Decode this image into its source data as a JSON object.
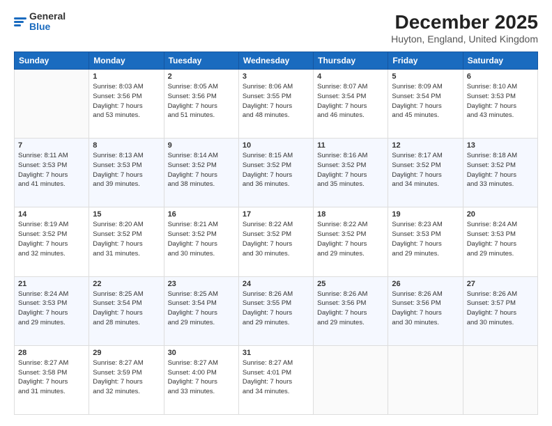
{
  "header": {
    "logo_general": "General",
    "logo_blue": "Blue",
    "month_title": "December 2025",
    "location": "Huyton, England, United Kingdom"
  },
  "days_of_week": [
    "Sunday",
    "Monday",
    "Tuesday",
    "Wednesday",
    "Thursday",
    "Friday",
    "Saturday"
  ],
  "weeks": [
    [
      {
        "day": "",
        "content": ""
      },
      {
        "day": "1",
        "content": "Sunrise: 8:03 AM\nSunset: 3:56 PM\nDaylight: 7 hours\nand 53 minutes."
      },
      {
        "day": "2",
        "content": "Sunrise: 8:05 AM\nSunset: 3:56 PM\nDaylight: 7 hours\nand 51 minutes."
      },
      {
        "day": "3",
        "content": "Sunrise: 8:06 AM\nSunset: 3:55 PM\nDaylight: 7 hours\nand 48 minutes."
      },
      {
        "day": "4",
        "content": "Sunrise: 8:07 AM\nSunset: 3:54 PM\nDaylight: 7 hours\nand 46 minutes."
      },
      {
        "day": "5",
        "content": "Sunrise: 8:09 AM\nSunset: 3:54 PM\nDaylight: 7 hours\nand 45 minutes."
      },
      {
        "day": "6",
        "content": "Sunrise: 8:10 AM\nSunset: 3:53 PM\nDaylight: 7 hours\nand 43 minutes."
      }
    ],
    [
      {
        "day": "7",
        "content": "Sunrise: 8:11 AM\nSunset: 3:53 PM\nDaylight: 7 hours\nand 41 minutes."
      },
      {
        "day": "8",
        "content": "Sunrise: 8:13 AM\nSunset: 3:53 PM\nDaylight: 7 hours\nand 39 minutes."
      },
      {
        "day": "9",
        "content": "Sunrise: 8:14 AM\nSunset: 3:52 PM\nDaylight: 7 hours\nand 38 minutes."
      },
      {
        "day": "10",
        "content": "Sunrise: 8:15 AM\nSunset: 3:52 PM\nDaylight: 7 hours\nand 36 minutes."
      },
      {
        "day": "11",
        "content": "Sunrise: 8:16 AM\nSunset: 3:52 PM\nDaylight: 7 hours\nand 35 minutes."
      },
      {
        "day": "12",
        "content": "Sunrise: 8:17 AM\nSunset: 3:52 PM\nDaylight: 7 hours\nand 34 minutes."
      },
      {
        "day": "13",
        "content": "Sunrise: 8:18 AM\nSunset: 3:52 PM\nDaylight: 7 hours\nand 33 minutes."
      }
    ],
    [
      {
        "day": "14",
        "content": "Sunrise: 8:19 AM\nSunset: 3:52 PM\nDaylight: 7 hours\nand 32 minutes."
      },
      {
        "day": "15",
        "content": "Sunrise: 8:20 AM\nSunset: 3:52 PM\nDaylight: 7 hours\nand 31 minutes."
      },
      {
        "day": "16",
        "content": "Sunrise: 8:21 AM\nSunset: 3:52 PM\nDaylight: 7 hours\nand 30 minutes."
      },
      {
        "day": "17",
        "content": "Sunrise: 8:22 AM\nSunset: 3:52 PM\nDaylight: 7 hours\nand 30 minutes."
      },
      {
        "day": "18",
        "content": "Sunrise: 8:22 AM\nSunset: 3:52 PM\nDaylight: 7 hours\nand 29 minutes."
      },
      {
        "day": "19",
        "content": "Sunrise: 8:23 AM\nSunset: 3:53 PM\nDaylight: 7 hours\nand 29 minutes."
      },
      {
        "day": "20",
        "content": "Sunrise: 8:24 AM\nSunset: 3:53 PM\nDaylight: 7 hours\nand 29 minutes."
      }
    ],
    [
      {
        "day": "21",
        "content": "Sunrise: 8:24 AM\nSunset: 3:53 PM\nDaylight: 7 hours\nand 29 minutes."
      },
      {
        "day": "22",
        "content": "Sunrise: 8:25 AM\nSunset: 3:54 PM\nDaylight: 7 hours\nand 28 minutes."
      },
      {
        "day": "23",
        "content": "Sunrise: 8:25 AM\nSunset: 3:54 PM\nDaylight: 7 hours\nand 29 minutes."
      },
      {
        "day": "24",
        "content": "Sunrise: 8:26 AM\nSunset: 3:55 PM\nDaylight: 7 hours\nand 29 minutes."
      },
      {
        "day": "25",
        "content": "Sunrise: 8:26 AM\nSunset: 3:56 PM\nDaylight: 7 hours\nand 29 minutes."
      },
      {
        "day": "26",
        "content": "Sunrise: 8:26 AM\nSunset: 3:56 PM\nDaylight: 7 hours\nand 30 minutes."
      },
      {
        "day": "27",
        "content": "Sunrise: 8:26 AM\nSunset: 3:57 PM\nDaylight: 7 hours\nand 30 minutes."
      }
    ],
    [
      {
        "day": "28",
        "content": "Sunrise: 8:27 AM\nSunset: 3:58 PM\nDaylight: 7 hours\nand 31 minutes."
      },
      {
        "day": "29",
        "content": "Sunrise: 8:27 AM\nSunset: 3:59 PM\nDaylight: 7 hours\nand 32 minutes."
      },
      {
        "day": "30",
        "content": "Sunrise: 8:27 AM\nSunset: 4:00 PM\nDaylight: 7 hours\nand 33 minutes."
      },
      {
        "day": "31",
        "content": "Sunrise: 8:27 AM\nSunset: 4:01 PM\nDaylight: 7 hours\nand 34 minutes."
      },
      {
        "day": "",
        "content": ""
      },
      {
        "day": "",
        "content": ""
      },
      {
        "day": "",
        "content": ""
      }
    ]
  ]
}
